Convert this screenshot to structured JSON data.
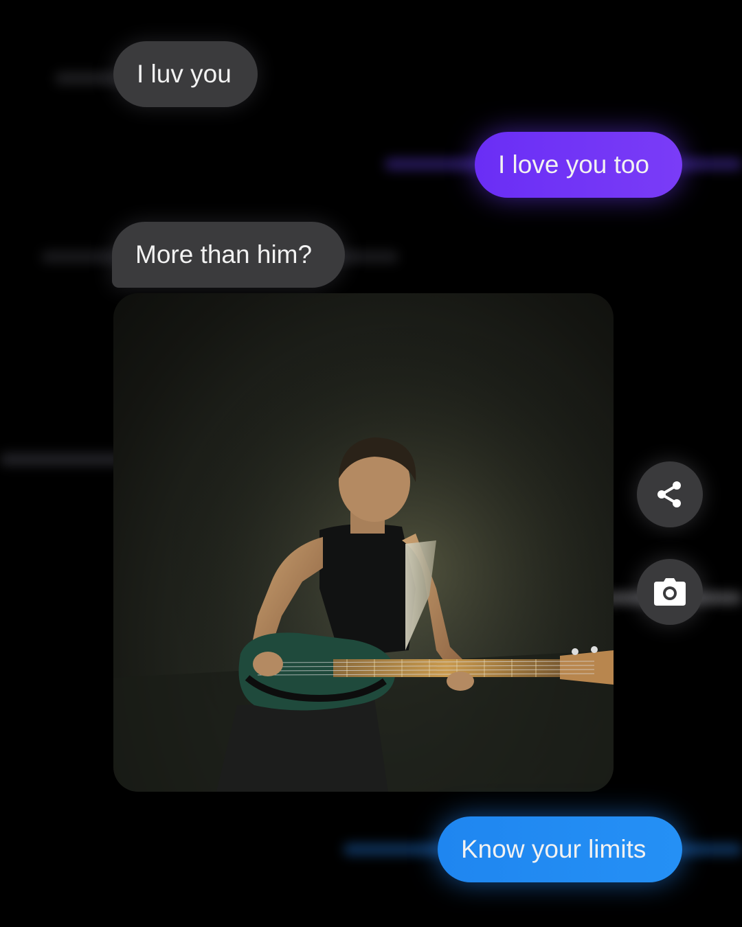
{
  "messages": [
    {
      "text": "I luv you",
      "direction": "incoming"
    },
    {
      "text": "I love you too",
      "direction": "outgoing",
      "color": "#6a2ef5"
    },
    {
      "text": "More than him?",
      "direction": "incoming"
    },
    {
      "text": "Know your limits",
      "direction": "outgoing",
      "color": "#1f86f0"
    }
  ],
  "attachment": {
    "type": "photo",
    "subject": "musician playing bass guitar on stage"
  },
  "actions": {
    "share_icon": "share-icon",
    "camera_icon": "camera-icon"
  },
  "theme": {
    "background": "#000000",
    "incoming_bubble": "#3b3b3d",
    "outgoing_purple": "#6a2ef5",
    "outgoing_blue": "#1f86f0"
  }
}
